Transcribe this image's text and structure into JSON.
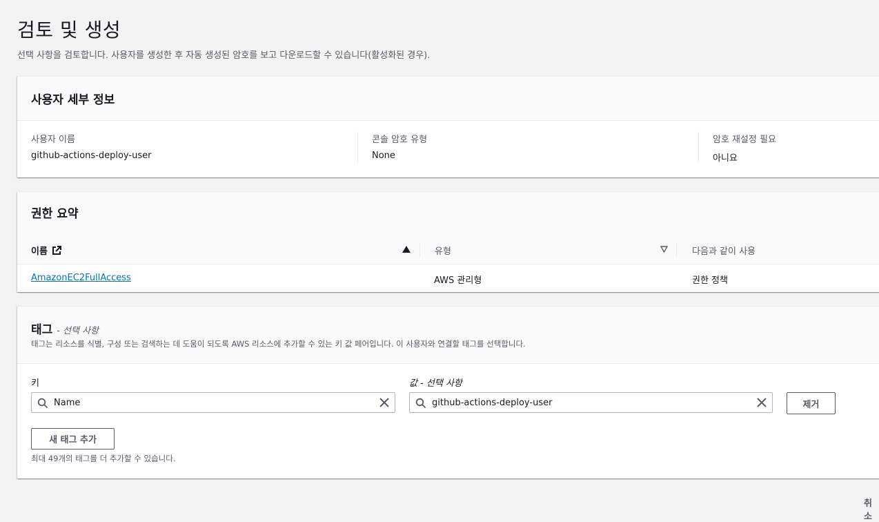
{
  "page": {
    "title": "검토 및 생성",
    "description": "선택 사항을 검토합니다. 사용자를 생성한 후 자동 생성된 암호를 보고 다운로드할 수 있습니다(활성화된 경우)."
  },
  "user_details": {
    "title": "사용자 세부 정보",
    "fields": [
      {
        "label": "사용자 이름",
        "value": "github-actions-deploy-user"
      },
      {
        "label": "콘솔 암호 유형",
        "value": "None"
      },
      {
        "label": "암호 재설정 필요",
        "value": "아니요"
      }
    ]
  },
  "permissions": {
    "title": "권한 요약",
    "columns": [
      "이름",
      "유형",
      "다음과 같이 사용"
    ],
    "rows": [
      {
        "name": "AmazonEC2FullAccess",
        "type": "AWS 관리형",
        "used_as": "권한 정책"
      }
    ]
  },
  "tags": {
    "title": "태그",
    "optional": "- 선택 사항",
    "description": "태그는 리소스를 식별, 구성 또는 검색하는 데 도움이 되도록 AWS 리소스에 추가할 수 있는 키 값 페어입니다. 이 사용자와 연결할 태그를 선택합니다.",
    "key_label": "키",
    "value_label": "값 - 선택 사항",
    "key_value": "Name",
    "value_value": "github-actions-deploy-user",
    "remove_label": "제거",
    "add_label": "새 태그 추가",
    "hint": "최대 49개의 태그를 더 추가할 수 있습니다."
  },
  "footer": {
    "cancel_label": "취소"
  },
  "colors": {
    "link": "#0073bb",
    "background": "#f2f3f3"
  }
}
